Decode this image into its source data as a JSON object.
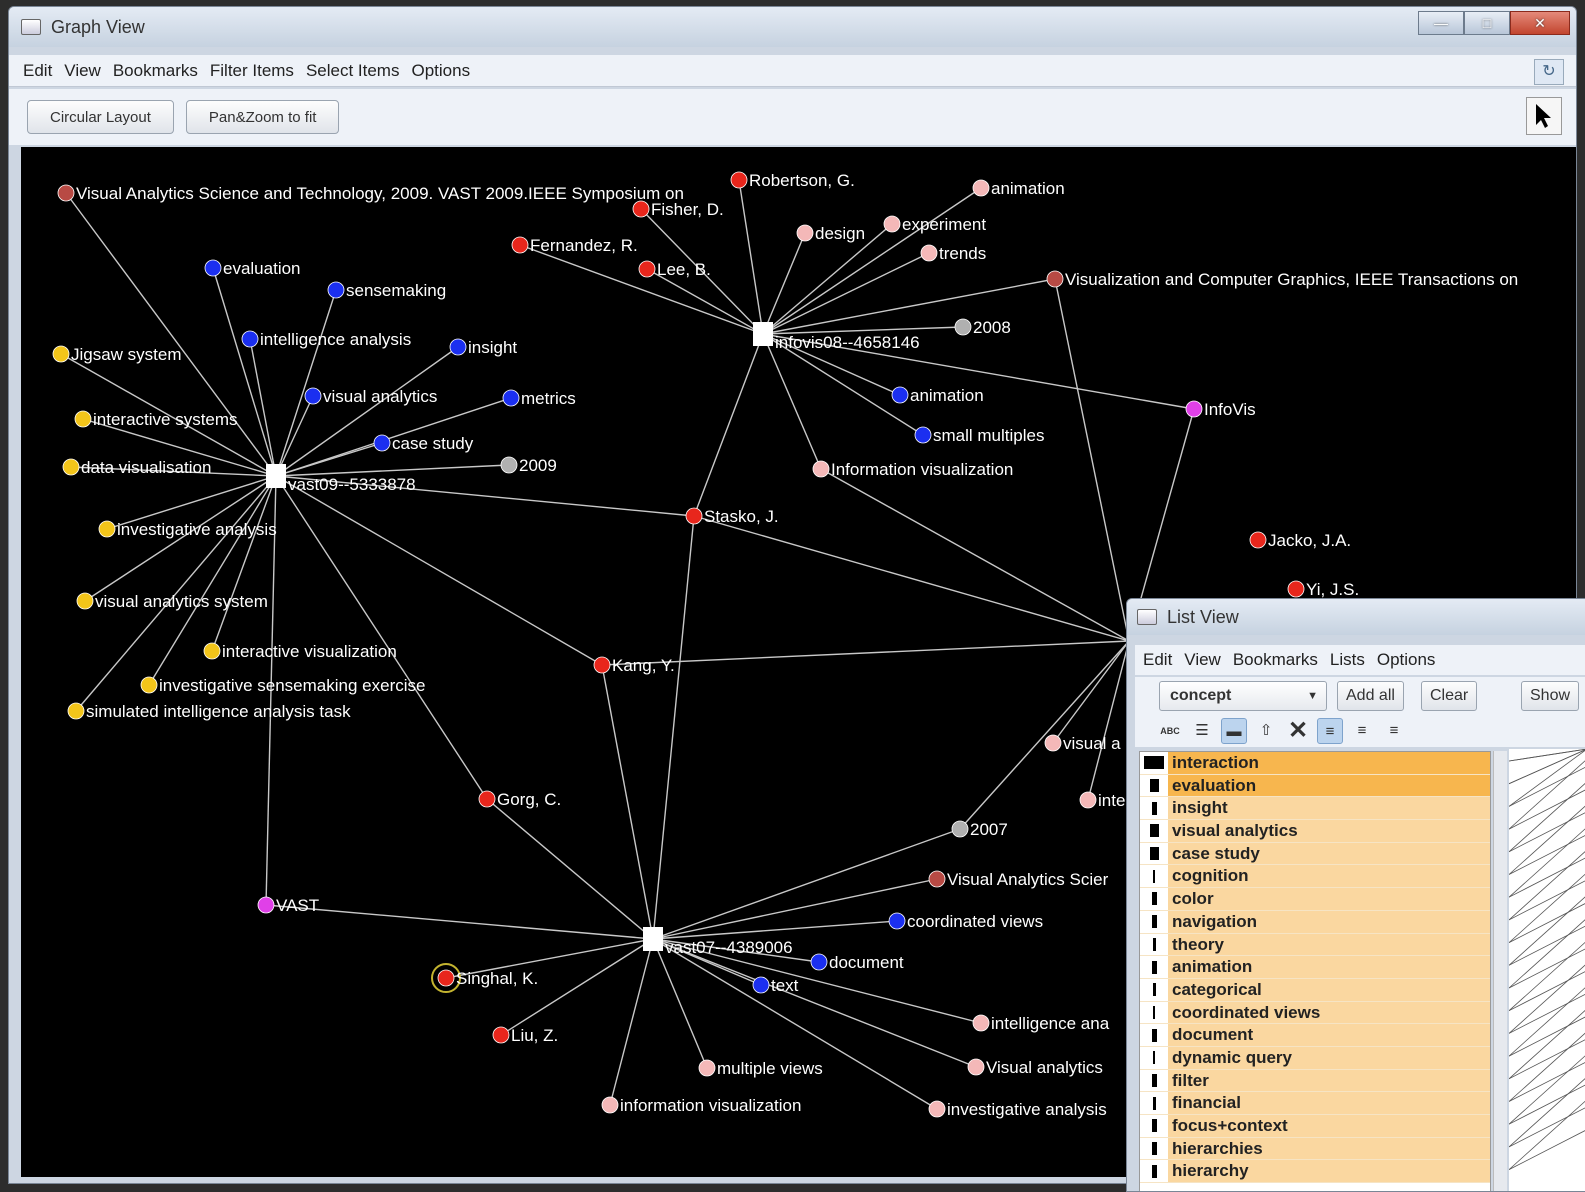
{
  "graph_window": {
    "title": "Graph View",
    "menu": [
      "Edit",
      "View",
      "Bookmarks",
      "Filter Items",
      "Select Items",
      "Options"
    ],
    "buttons": {
      "circular_layout": "Circular Layout",
      "pan_zoom": "Pan&Zoom to fit"
    },
    "colors": {
      "canvas": "#000000",
      "person": "#e8261c",
      "concept_vast09": "#1b2ff0",
      "keyword": "#f3c51a",
      "concept_infovis": "#f4b8b8",
      "year": "#b0b0b0",
      "venue": "#b84a44",
      "conference": "#e040e8",
      "document": "#ffffff"
    }
  },
  "graph": {
    "hubs": [
      {
        "id": "vast09",
        "label": "vast09--5333878"
      },
      {
        "id": "infovis08",
        "label": "infovis08--4658146"
      },
      {
        "id": "vast07",
        "label": "vast07--4389006"
      }
    ],
    "nodes": [
      {
        "label": "Visual Analytics Science and Technology, 2009. VAST 2009.IEEE Symposium on",
        "type": "venue"
      },
      {
        "label": "evaluation",
        "type": "concept_vast09"
      },
      {
        "label": "sensemaking",
        "type": "concept_vast09"
      },
      {
        "label": "intelligence analysis",
        "type": "concept_vast09"
      },
      {
        "label": "insight",
        "type": "concept_vast09"
      },
      {
        "label": "Jigsaw system",
        "type": "keyword"
      },
      {
        "label": "visual analytics",
        "type": "concept_vast09"
      },
      {
        "label": "metrics",
        "type": "concept_vast09"
      },
      {
        "label": "interactive systems",
        "type": "keyword"
      },
      {
        "label": "case study",
        "type": "concept_vast09"
      },
      {
        "label": "data visualisation",
        "type": "keyword"
      },
      {
        "label": "2009",
        "type": "year"
      },
      {
        "label": "investigative analysis",
        "type": "keyword"
      },
      {
        "label": "visual analytics system",
        "type": "keyword"
      },
      {
        "label": "interactive visualization",
        "type": "keyword"
      },
      {
        "label": "investigative sensemaking exercise",
        "type": "keyword"
      },
      {
        "label": "simulated intelligence analysis task",
        "type": "keyword"
      },
      {
        "label": "Robertson, G.",
        "type": "person"
      },
      {
        "label": "Fisher, D.",
        "type": "person"
      },
      {
        "label": "Fernandez, R.",
        "type": "person"
      },
      {
        "label": "Lee, B.",
        "type": "person"
      },
      {
        "label": "animation",
        "type": "concept_infovis"
      },
      {
        "label": "design",
        "type": "concept_infovis"
      },
      {
        "label": "experiment",
        "type": "concept_infovis"
      },
      {
        "label": "trends",
        "type": "concept_infovis"
      },
      {
        "label": "Visualization and Computer Graphics, IEEE Transactions on",
        "type": "venue"
      },
      {
        "label": "2008",
        "type": "year"
      },
      {
        "label": "animation",
        "type": "concept_vast09"
      },
      {
        "label": "InfoVis",
        "type": "conference"
      },
      {
        "label": "small multiples",
        "type": "concept_vast09"
      },
      {
        "label": "Information visualization",
        "type": "concept_infovis"
      },
      {
        "label": "Stasko, J.",
        "type": "person"
      },
      {
        "label": "Jacko, J.A.",
        "type": "person"
      },
      {
        "label": "Yi, J.S.",
        "type": "person"
      },
      {
        "label": "Kang, Y.",
        "type": "person"
      },
      {
        "label": "visual a",
        "type": "concept_infovis"
      },
      {
        "label": "inte",
        "type": "concept_infovis"
      },
      {
        "label": "Gorg, C.",
        "type": "person"
      },
      {
        "label": "2007",
        "type": "year"
      },
      {
        "label": "Visual Analytics Scier",
        "type": "venue"
      },
      {
        "label": "VAST",
        "type": "conference"
      },
      {
        "label": "coordinated views",
        "type": "concept_vast09"
      },
      {
        "label": "document",
        "type": "concept_vast09"
      },
      {
        "label": "Singhal, K.",
        "type": "person"
      },
      {
        "label": "text",
        "type": "concept_vast09"
      },
      {
        "label": "intelligence ana",
        "type": "concept_infovis"
      },
      {
        "label": "Liu, Z.",
        "type": "person"
      },
      {
        "label": "multiple views",
        "type": "concept_infovis"
      },
      {
        "label": "Visual analytics",
        "type": "concept_infovis"
      },
      {
        "label": "information visualization",
        "type": "concept_infovis"
      },
      {
        "label": "investigative analysis",
        "type": "concept_infovis"
      }
    ]
  },
  "list_window": {
    "title": "List View",
    "menu": [
      "Edit",
      "View",
      "Bookmarks",
      "Lists",
      "Options"
    ],
    "selector_value": "concept",
    "add_all": "Add all",
    "clear": "Clear",
    "show": "Show",
    "items": [
      {
        "label": "interaction",
        "weight": 1.0,
        "highlighted": true
      },
      {
        "label": "evaluation",
        "weight": 0.45,
        "highlighted": true
      },
      {
        "label": "insight",
        "weight": 0.25,
        "highlighted": false
      },
      {
        "label": "visual analytics",
        "weight": 0.45,
        "highlighted": false
      },
      {
        "label": "case study",
        "weight": 0.45,
        "highlighted": false
      },
      {
        "label": "cognition",
        "weight": 0.1,
        "highlighted": false
      },
      {
        "label": "color",
        "weight": 0.25,
        "highlighted": false
      },
      {
        "label": "navigation",
        "weight": 0.25,
        "highlighted": false
      },
      {
        "label": "theory",
        "weight": 0.15,
        "highlighted": false
      },
      {
        "label": "animation",
        "weight": 0.25,
        "highlighted": false
      },
      {
        "label": "categorical",
        "weight": 0.15,
        "highlighted": false
      },
      {
        "label": "coordinated views",
        "weight": 0.1,
        "highlighted": false
      },
      {
        "label": "document",
        "weight": 0.25,
        "highlighted": false
      },
      {
        "label": "dynamic query",
        "weight": 0.1,
        "highlighted": false
      },
      {
        "label": "filter",
        "weight": 0.25,
        "highlighted": false
      },
      {
        "label": "financial",
        "weight": 0.15,
        "highlighted": false
      },
      {
        "label": "focus+context",
        "weight": 0.25,
        "highlighted": false
      },
      {
        "label": "hierarchies",
        "weight": 0.25,
        "highlighted": false
      },
      {
        "label": "hierarchy",
        "weight": 0.25,
        "highlighted": false
      }
    ]
  }
}
